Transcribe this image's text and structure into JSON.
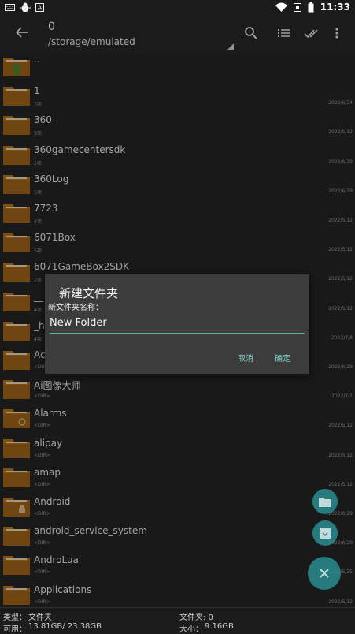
{
  "status_bar": {
    "time": "11:33",
    "icons": [
      "keyboard-icon",
      "bug-icon",
      "android-a-icon",
      "wifi-icon",
      "mute-icon",
      "battery-icon"
    ]
  },
  "toolbar": {
    "title": "0",
    "path": "/storage/emulated",
    "icons": [
      "back-arrow-icon",
      "search-icon",
      "list-view-icon",
      "double-check-icon",
      "more-vert-icon"
    ]
  },
  "files": [
    {
      "name": "..",
      "meta": "",
      "date": "",
      "icon": "folder-up-icon"
    },
    {
      "name": "1",
      "meta": "7项",
      "date": "2022/6/24",
      "icon": "folder-icon"
    },
    {
      "name": "360",
      "meta": "5项",
      "date": "2022/5/12",
      "icon": "folder-icon"
    },
    {
      "name": "360gamecentersdk",
      "meta": "2项",
      "date": "2022/6/29",
      "icon": "folder-icon"
    },
    {
      "name": "360Log",
      "meta": "1项",
      "date": "2022/6/29",
      "icon": "folder-icon"
    },
    {
      "name": "7723",
      "meta": "4项",
      "date": "2022/5/12",
      "icon": "folder-icon"
    },
    {
      "name": "6071Box",
      "meta": "5项",
      "date": "2022/5/12",
      "icon": "folder-icon"
    },
    {
      "name": "6071GameBox2SDK",
      "meta": "2项",
      "date": "2022/5/12",
      "icon": "folder-icon"
    },
    {
      "name": "__",
      "meta": "4项",
      "date": "2022/5/12",
      "icon": "folder-icon"
    },
    {
      "name": "_h",
      "meta": "4项",
      "date": "2022/7/8",
      "icon": "folder-icon"
    },
    {
      "name": "Ac",
      "meta": "<DIR>",
      "date": "2022/6/29",
      "icon": "folder-icon"
    },
    {
      "name": "Ai图像大师",
      "meta": "<DIR>",
      "date": "2022/7/1",
      "icon": "folder-icon"
    },
    {
      "name": "Alarms",
      "meta": "<DIR>",
      "date": "2022/5/12",
      "icon": "folder-alarm-icon"
    },
    {
      "name": "alipay",
      "meta": "<DIR>",
      "date": "2022/5/12",
      "icon": "folder-icon"
    },
    {
      "name": "amap",
      "meta": "<DIR>",
      "date": "2022/5/12",
      "icon": "folder-icon"
    },
    {
      "name": "Android",
      "meta": "<DIR>",
      "date": "2022/6/29",
      "icon": "folder-android-icon"
    },
    {
      "name": "android_service_system",
      "meta": "<DIR>",
      "date": "2022/6/29",
      "icon": "folder-icon"
    },
    {
      "name": "AndroLua",
      "meta": "<DIR>",
      "date": "2022/5/25",
      "icon": "folder-icon"
    },
    {
      "name": "Applications",
      "meta": "<DIR>",
      "date": "2022/5/12",
      "icon": "folder-icon"
    }
  ],
  "dialog": {
    "title": "新建文件夹",
    "label": "新文件夹名称：",
    "input_value": "New Folder",
    "cancel": "取消",
    "confirm": "确定"
  },
  "fabs": {
    "icons": [
      "new-folder-icon",
      "archive-icon",
      "close-icon"
    ]
  },
  "bottom_bar": {
    "type_label": "类型：",
    "type_value": "文件夹",
    "avail_label": "可用：",
    "avail_value": "13.81GB/ 23.38GB",
    "folder_label": "文件夹: 0",
    "size_label": "大小：",
    "size_value": "9.16GB"
  },
  "colors": {
    "accent": "#4fb3a7",
    "folder": "#a0661c",
    "fab": "#2a8c90"
  }
}
